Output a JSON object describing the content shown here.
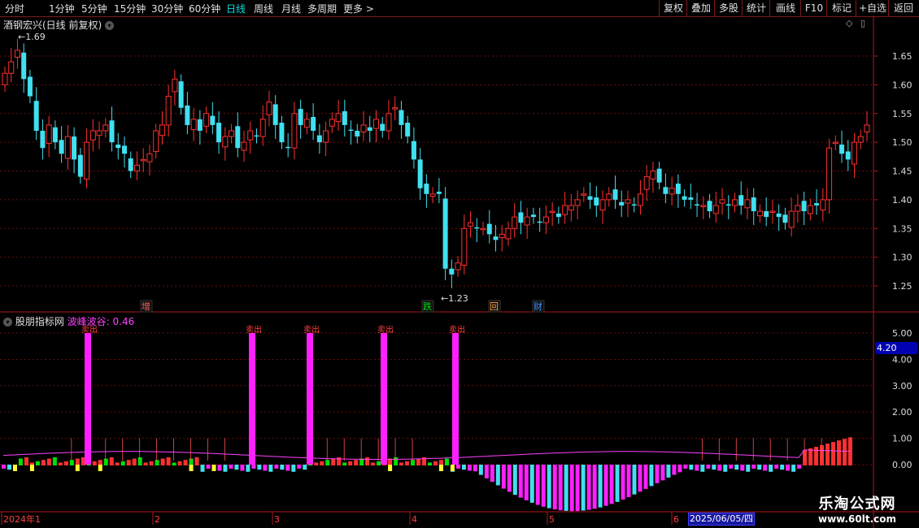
{
  "toolbar": {
    "periods": [
      "分时",
      "1分钟",
      "5分钟",
      "15分钟",
      "30分钟",
      "60分钟",
      "日线",
      "周线",
      "月线",
      "多周期",
      "更多 >"
    ],
    "active_period": "日线",
    "right_buttons": [
      "复权",
      "叠加",
      "多股",
      "统计",
      "画线",
      "F10",
      "标记",
      "+自选",
      "返回"
    ]
  },
  "main_chart": {
    "title": "酒钢宏兴(日线 前复权)",
    "high_label": "1.69",
    "low_label": "1.23",
    "price_ticks": [
      "1.65",
      "1.60",
      "1.55",
      "1.50",
      "1.45",
      "1.40",
      "1.35",
      "1.30",
      "1.25"
    ],
    "event_labels": [
      {
        "text": "增",
        "color": "#ff6060"
      },
      {
        "text": "跌",
        "color": "#00e000"
      },
      {
        "text": "回",
        "color": "#ffa040"
      },
      {
        "text": "财",
        "color": "#4090ff"
      }
    ]
  },
  "indicator": {
    "source": "股朋指标网",
    "name": "波峰波谷:",
    "value": "0.46",
    "ticks": [
      "5.00",
      "4.00",
      "3.00",
      "2.00",
      "1.00",
      "0.00"
    ],
    "current_value": "4.20",
    "spike_label": "卖出"
  },
  "date_axis": {
    "labels": [
      "2024年1",
      "2",
      "3",
      "4",
      "5",
      "6"
    ],
    "cursor_date": "2025/06/05/四"
  },
  "watermark": {
    "title": "乐淘公式网",
    "url": "www.60lt.com"
  },
  "colors": {
    "up": "#ff3030",
    "down": "#40e0f0",
    "magenta": "#ff20ff",
    "grid": "#8a1010"
  }
}
